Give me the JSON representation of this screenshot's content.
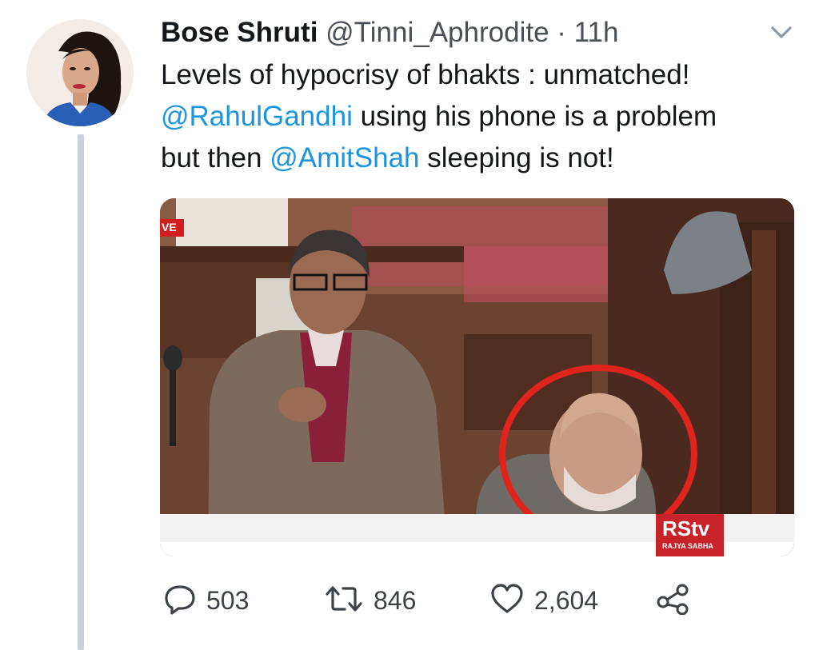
{
  "tweet": {
    "display_name": "Bose Shruti",
    "handle": "@Tinni_Aphrodite",
    "separator": "·",
    "time": "11h",
    "text_line1": "Levels of hypocrisy of bhakts : unmatched!",
    "mention1": "@RahulGandhi",
    "text_line2_rest": " using his phone is a problem",
    "text_line3_start": "but then ",
    "mention2": "@AmitShah",
    "text_line3_rest": " sleeping is not!"
  },
  "media": {
    "live_badge": "VE",
    "channel_logo": "RStv",
    "channel_subtitle": "RAJYA SABHA"
  },
  "actions": {
    "reply_count": "503",
    "retweet_count": "846",
    "like_count": "2,604"
  },
  "colors": {
    "link": "#1b95e0",
    "text": "#14171a",
    "secondary": "#4a4f55",
    "thread_line": "#c8d3dd",
    "highlight_circle": "#e0231c"
  },
  "icons": {
    "more": "chevron-down-icon",
    "reply": "reply-icon",
    "retweet": "retweet-icon",
    "like": "heart-icon",
    "share": "share-icon"
  }
}
